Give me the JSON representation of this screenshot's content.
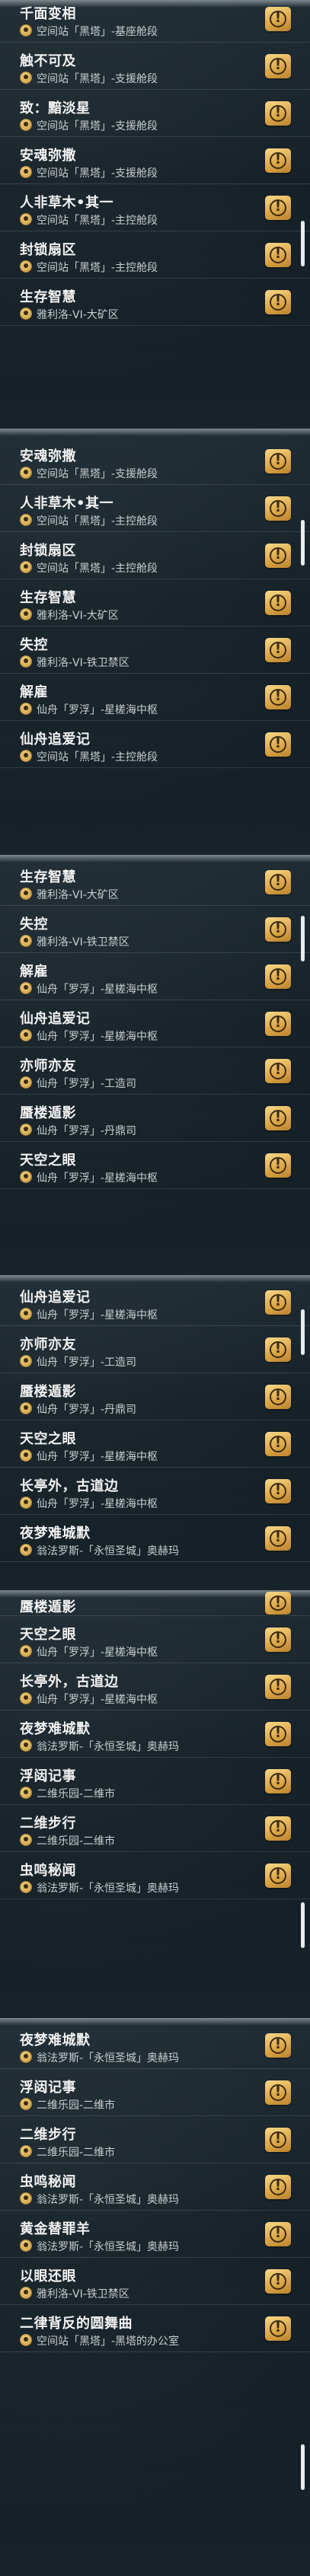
{
  "segments": [
    {
      "items": [
        {
          "title": "千面变相",
          "location": "空间站「黑塔」-基座舱段"
        },
        {
          "title": "触不可及",
          "location": "空间站「黑塔」-支援舱段"
        },
        {
          "title": "致：黯淡星",
          "location": "空间站「黑塔」-支援舱段"
        },
        {
          "title": "安魂弥撒",
          "location": "空间站「黑塔」-支援舱段"
        },
        {
          "title": "人非草木•其一",
          "location": "空间站「黑塔」-主控舱段"
        },
        {
          "title": "封锁扇区",
          "location": "空间站「黑塔」-主控舱段"
        },
        {
          "title": "生存智慧",
          "location": "雅利洛-VI-大矿区"
        }
      ]
    },
    {
      "items": [
        {
          "title": "安魂弥撒",
          "location": "空间站「黑塔」-支援舱段"
        },
        {
          "title": "人非草木•其一",
          "location": "空间站「黑塔」-主控舱段"
        },
        {
          "title": "封锁扇区",
          "location": "空间站「黑塔」-主控舱段"
        },
        {
          "title": "生存智慧",
          "location": "雅利洛-VI-大矿区"
        },
        {
          "title": "失控",
          "location": "雅利洛-VI-铁卫禁区"
        },
        {
          "title": "解雇",
          "location": "仙舟「罗浮」-星槎海中枢"
        },
        {
          "title": "仙舟追爱记",
          "location": "空间站「黑塔」-主控舱段"
        }
      ]
    },
    {
      "items": [
        {
          "title": "生存智慧",
          "location": "雅利洛-VI-大矿区"
        },
        {
          "title": "失控",
          "location": "雅利洛-VI-铁卫禁区"
        },
        {
          "title": "解雇",
          "location": "仙舟「罗浮」-星槎海中枢"
        },
        {
          "title": "仙舟追爱记",
          "location": "仙舟「罗浮」-星槎海中枢"
        },
        {
          "title": "亦师亦友",
          "location": "仙舟「罗浮」-工造司"
        },
        {
          "title": "蜃楼遁影",
          "location": "仙舟「罗浮」-丹鼎司"
        },
        {
          "title": "天空之眼",
          "location": "仙舟「罗浮」-星槎海中枢"
        }
      ]
    },
    {
      "items": [
        {
          "title": "仙舟追爱记",
          "location": "仙舟「罗浮」-星槎海中枢"
        },
        {
          "title": "亦师亦友",
          "location": "仙舟「罗浮」-工造司"
        },
        {
          "title": "蜃楼遁影",
          "location": "仙舟「罗浮」-丹鼎司"
        },
        {
          "title": "天空之眼",
          "location": "仙舟「罗浮」-星槎海中枢"
        },
        {
          "title": "长亭外，古道边",
          "location": "仙舟「罗浮」-星槎海中枢"
        },
        {
          "title": "夜梦难城默",
          "location": "翁法罗斯-「永恒圣城」奥赫玛"
        }
      ]
    },
    {
      "items": [
        {
          "title": "蜃楼遁影",
          "location": ""
        },
        {
          "title": "天空之眼",
          "location": "仙舟「罗浮」-星槎海中枢"
        },
        {
          "title": "长亭外，古道边",
          "location": "仙舟「罗浮」-星槎海中枢"
        },
        {
          "title": "夜梦难城默",
          "location": "翁法罗斯-「永恒圣城」奥赫玛"
        },
        {
          "title": "浮闼记事",
          "location": "二维乐园-二维市"
        },
        {
          "title": "二维步行",
          "location": "二维乐园-二维市"
        },
        {
          "title": "虫鸣秘闻",
          "location": "翁法罗斯-「永恒圣城」奥赫玛"
        }
      ]
    },
    {
      "items": [
        {
          "title": "夜梦难城默",
          "location": "翁法罗斯-「永恒圣城」奥赫玛"
        },
        {
          "title": "浮闼记事",
          "location": "二维乐园-二维市"
        },
        {
          "title": "二维步行",
          "location": "二维乐园-二维市"
        },
        {
          "title": "虫鸣秘闻",
          "location": "翁法罗斯-「永恒圣城」奥赫玛"
        },
        {
          "title": "黄金替罪羊",
          "location": "翁法罗斯-「永恒圣城」奥赫玛"
        },
        {
          "title": "以眼还眼",
          "location": "雅利洛-VI-铁卫禁区"
        },
        {
          "title": "二律背反的圆舞曲",
          "location": "空间站「黑塔」-黑塔的办公室"
        }
      ]
    }
  ]
}
